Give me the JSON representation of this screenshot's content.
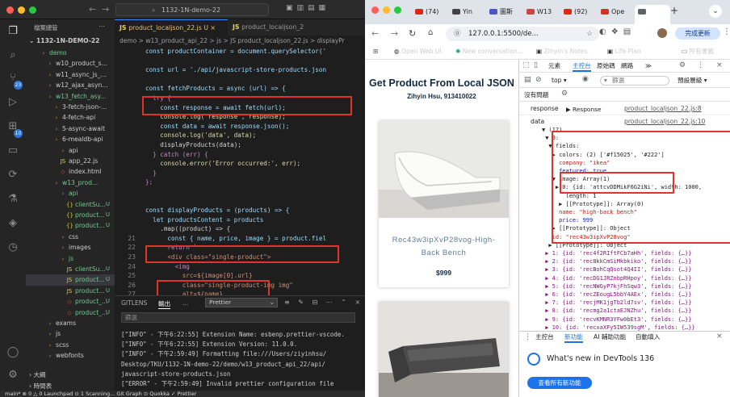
{
  "vscode": {
    "search": "1132-1N-demo-22",
    "explorer_title": "檔案總管",
    "root": "1132-1N-DEMO-22",
    "tree": [
      {
        "label": "demo",
        "icon": "folder",
        "badge": "",
        "green": true
      },
      {
        "label": "w10_product_s...",
        "icon": "folder",
        "badge": "",
        "green": false
      },
      {
        "label": "w11_async_js_...",
        "icon": "folder",
        "badge": "",
        "green": false
      },
      {
        "label": "w12_ajax_asyn...",
        "icon": "folder",
        "badge": "",
        "green": false
      },
      {
        "label": "w13_fetch_asy...",
        "icon": "folder",
        "badge": "",
        "green": true
      },
      {
        "label": "3-fetch-json-...",
        "icon": "folder",
        "badge": "",
        "green": false
      },
      {
        "label": "4-fetch-api",
        "icon": "folder",
        "badge": "",
        "green": false
      },
      {
        "label": "5-async-await",
        "icon": "folder",
        "badge": "",
        "green": false
      },
      {
        "label": "6-mealdb-api",
        "icon": "folder",
        "badge": "",
        "green": false
      },
      {
        "label": "api",
        "icon": "folder",
        "badge": "",
        "green": false
      },
      {
        "label": "app_22.js",
        "icon": "js",
        "badge": "",
        "green": false
      },
      {
        "label": "index.html",
        "icon": "html",
        "badge": "",
        "green": false
      },
      {
        "label": "w13_prod...",
        "icon": "folder",
        "badge": "",
        "green": true
      },
      {
        "label": "api",
        "icon": "folder",
        "badge": "",
        "green": true
      },
      {
        "label": "clientSu...",
        "icon": "json",
        "badge": "U",
        "green": true
      },
      {
        "label": "product...",
        "icon": "json",
        "badge": "U",
        "green": true
      },
      {
        "label": "product...",
        "icon": "json",
        "badge": "U",
        "green": true
      },
      {
        "label": "css",
        "icon": "folder",
        "badge": "",
        "green": false
      },
      {
        "label": "images",
        "icon": "folder",
        "badge": "",
        "green": false
      },
      {
        "label": "js",
        "icon": "folder",
        "badge": "",
        "green": true
      },
      {
        "label": "clientSu...",
        "icon": "js",
        "badge": "U",
        "green": true
      },
      {
        "label": "product...",
        "icon": "js",
        "badge": "U",
        "green": true
      },
      {
        "label": "product...",
        "icon": "js",
        "badge": "U",
        "green": true
      },
      {
        "label": "product_...",
        "icon": "html",
        "badge": "U",
        "green": true
      },
      {
        "label": "product_...",
        "icon": "html",
        "badge": "U",
        "green": true
      },
      {
        "label": "exams",
        "icon": "folder",
        "badge": "",
        "green": false
      },
      {
        "label": "js",
        "icon": "folder",
        "badge": "",
        "green": false
      },
      {
        "label": "scss",
        "icon": "folder",
        "badge": "",
        "green": false
      },
      {
        "label": "webfonts",
        "icon": "folder",
        "badge": "",
        "green": false
      }
    ],
    "outline": "大綱",
    "timeline": "時間表",
    "tabs": [
      "product_localjson_22.js U",
      "product_localjson_2"
    ],
    "breadcrumb": "demo > w13_product_api_22 > js > JS product_localjson_22.js > displayPr",
    "line_numbers": [
      "",
      "",
      "",
      "",
      "",
      "",
      "",
      "",
      "",
      "",
      "",
      "",
      "",
      "",
      "",
      "",
      "",
      "",
      "",
      "",
      "21",
      "22",
      "23",
      "24",
      "25",
      "26",
      "27"
    ],
    "code_lines": [
      "const productContainer = document.querySelector('",
      "",
      "const url = './api/javascript-store-products.json",
      "",
      "const fetchProducts = async (url) => {",
      "  try {",
      "    const response = await fetch(url);",
      "    console.log('response', response);",
      "    const data = await response.json();",
      "    console.log('data', data);",
      "    displayProducts(data);",
      "  } catch (err) {",
      "    console.error('Error occurred:', err);",
      "  }",
      "};",
      "",
      "",
      "const displayProducts = (products) => {",
      "  let productsContent = products",
      "    .map((product) => {",
      "      const { name, price, image } = product.fiel",
      "      return `",
      "      <div class=\"single-product\">",
      "        <img",
      "          src=${image[0].url}",
      "          class=\"single-product-img img\"",
      "          alt=${name}"
    ],
    "panel_tabs": [
      "GITLENS",
      "輸出",
      "..."
    ],
    "panel_select": "Prettier",
    "filter_placeholder": "篩選",
    "output": [
      "[\"INFO\" - 下午6:22:55] Extension Name: esbenp.prettier-vscode.",
      "[\"INFO\" - 下午6:22:55] Extension Version: 11.0.0.",
      "[\"INFO\" - 下午2:59:49] Formatting file:///Users/ziyinhsu/",
      "Desktop/TKU/1132-1N-demo-22/demo/w13_product_api_22/api/",
      "javascript-store-products.json",
      "[\"ERROR\" - 下午2:59:49] Invalid prettier configuration file",
      "detected."
    ],
    "status": "main*  ⊗ 0 △ 0   Launchpad   ⊙ 1  Scanning...   Git Graph   ⊙ Quokka   ✓ Prettier"
  },
  "chrome": {
    "tabs": [
      {
        "label": "(74)",
        "color": "#e62117"
      },
      {
        "label": "Yin",
        "color": "#444"
      },
      {
        "label": "圖斯",
        "color": "#4a55c9"
      },
      {
        "label": "W13",
        "color": "#c44"
      },
      {
        "label": "(92)",
        "color": "#e62117"
      },
      {
        "label": "Ope",
        "color": "#d93025"
      },
      {
        "label": "",
        "color": "#5f6368"
      }
    ],
    "url": "127.0.0.1:5500/de...",
    "update_button": "完成更新",
    "bookmarks": [
      "Open Web UI",
      "New conversation...",
      "Zihyin's Notes",
      "Life Plan"
    ],
    "all_bookmarks": "所有書籤",
    "page_title": "Get Product From Local JSON",
    "page_subtitle": "Zihyin Hsu, 913410022",
    "product_name": "Rec43w3ipXvP28vog-High-Back Bench",
    "product_price": "$999"
  },
  "devtools": {
    "tabs": [
      "元素",
      "主控台",
      "原始碼",
      "網路",
      "≫"
    ],
    "context": "top",
    "filter_placeholder": "篩選",
    "levels": "預設層級",
    "issues": "沒有問題",
    "log1_label": "response",
    "log1_value": "▶ Response",
    "log1_link": "product_localjson_22.js:8",
    "log2_label": "data",
    "log2_link": "product_localjson_22.js:10",
    "tree": [
      "▼ (12)",
      " ▼ 0:",
      "  ▼ fields:",
      "   ▶ colors: (2) ['#f15025', '#222']",
      "     company: \"ikea\"",
      "     featured: true",
      "   ▼ image: Array(1)",
      "    ▶ 0: {id: 'attcvDDMikF6G2iNi', width: 1000,",
      "       length: 1",
      "     ▶ [[Prototype]]: Array(0)",
      "     name: \"high-back bench\"",
      "     price: 999",
      "   ▶ [[Prototype]]: Object",
      "   id: \"rec43w3ipXvP28vog\"",
      "  ▶ [[Prototype]]: Object",
      " ▶ 1: {id: 'rec4f2RIftFCb7aHh', fields: {…}}",
      " ▶ 2: {id: 'rec8kkCmSiMkbkiko', fields: {…}}",
      " ▶ 3: {id: 'recBohCqQsot4Q4II', fields: {…}}",
      " ▶ 4: {id: 'recDG1JRZnbpRHpoy', fields: {…}}",
      " ▶ 5: {id: 'recNWGyP7kjFhSqw3', fields: {…}}",
      " ▶ 6: {id: 'recZEougL5bbY4AEx', fields: {…}}",
      " ▶ 7: {id: 'recjMK1jgTb2ld7sv', fields: {…}}",
      " ▶ 8: {id: 'recmg2a1ctaEJNZhu', fields: {…}}",
      " ▶ 9: {id: 'recvKMNR3YFw0bEt3', fields: {…}}",
      " ▶ 10: {id: 'recxaXFy5IW539sgM', fields: {…}}"
    ],
    "drawer_tabs": [
      "主控台",
      "新功能",
      "AI 輔助功能",
      "自動填入"
    ],
    "whats_new": "What's new in DevTools 136",
    "whats_new_button": "查看所有新功能"
  }
}
